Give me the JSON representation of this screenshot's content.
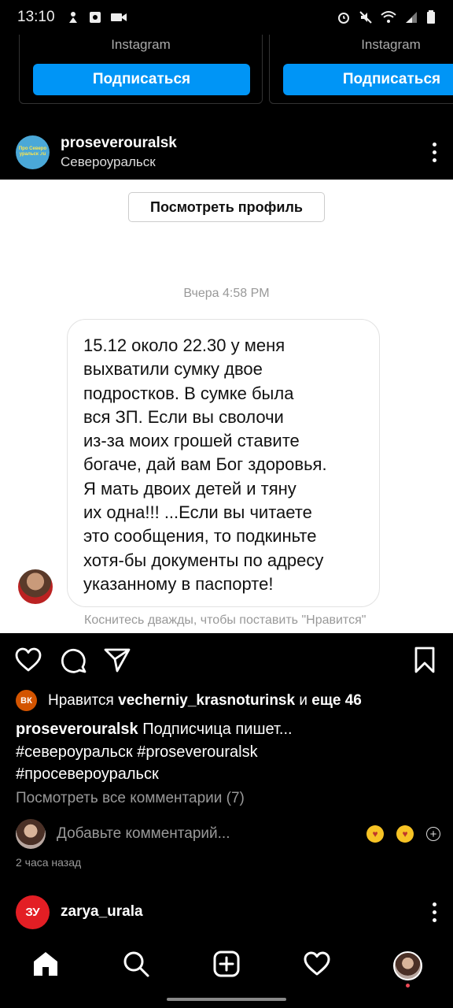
{
  "status_bar": {
    "time": "13:10",
    "left_icons": [
      "person-icon",
      "app-icon",
      "video-icon"
    ],
    "right_icons": [
      "alarm-icon",
      "mute-icon",
      "wifi-icon",
      "signal-icon",
      "battery-icon"
    ]
  },
  "suggestions": {
    "cards": [
      {
        "source": "Instagram",
        "button": "Подписаться"
      },
      {
        "source": "Instagram",
        "button": "Подписаться"
      }
    ]
  },
  "post": {
    "username": "proseverouralsk",
    "location": "Североуральск",
    "avatar_text": "Про Северо уральск .ru",
    "image": {
      "view_profile": "Посмотреть профиль",
      "message_time": "Вчера 4:58 PM",
      "message": "15.12  около 22.30 у меня\nвыхватили сумку двое\nподростков. В сумке была\nвся ЗП. Если вы сволочи\nиз-за моих грошей ставите\nбогаче, дай вам Бог здоровья.\nЯ мать двоих детей и тяну\nих одна!!! ...Если вы читаете\nэто сообщения, то подкиньте\nхотя-бы документы по адресу\nуказанному в паспорте!",
      "double_tap_hint": "Коснитесь дважды, чтобы поставить \"Нравится\""
    },
    "likes": {
      "badge": "ВК",
      "prefix": "Нравится",
      "liker": "vecherniy_krasnoturinsk",
      "middle": "и",
      "others": "еще 46"
    },
    "caption": {
      "username": "proseverouralsk",
      "text": "Подписчица пишет...",
      "hashtags": [
        "#североуральск",
        "#proseverouralsk",
        "#просевероуральск"
      ]
    },
    "view_comments": "Посмотреть все комментарии (7)",
    "add_comment_placeholder": "Добавьте комментарий...",
    "time_ago": "2 часа назад"
  },
  "next_post": {
    "username": "zarya_urala",
    "avatar_text": "ЗУ"
  },
  "bottom_nav": [
    "home-icon",
    "search-icon",
    "add-post-icon",
    "activity-heart-icon",
    "profile-avatar"
  ],
  "colors": {
    "accent": "#0095f6",
    "background": "#000000",
    "notification": "#ed4956"
  }
}
